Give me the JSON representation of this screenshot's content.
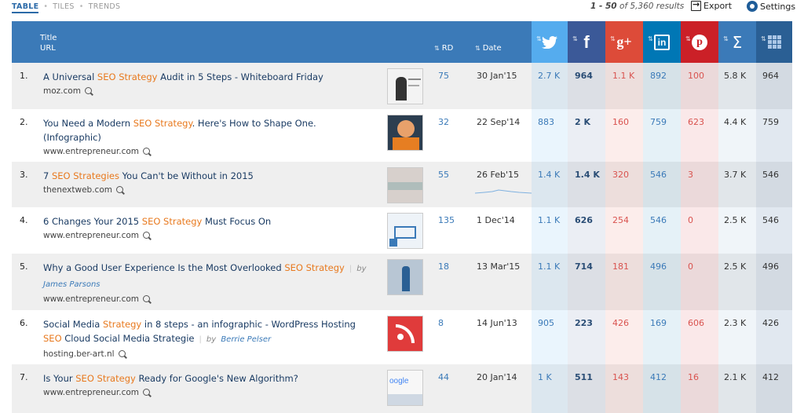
{
  "toolbar": {
    "view_table": "TABLE",
    "view_tiles": "TILES",
    "view_trends": "TRENDS",
    "results_range": "1 - 50",
    "results_text": "of 5,360 results",
    "export_label": "Export",
    "settings_label": "Settings"
  },
  "header": {
    "title_label": "Title",
    "url_label": "URL",
    "rd_label": "RD",
    "date_label": "Date",
    "twitter_icon": "twitter-icon",
    "facebook_icon": "facebook-icon",
    "googleplus_icon": "google-plus-icon",
    "linkedin_icon": "linkedin-icon",
    "pinterest_icon": "pinterest-icon",
    "total_icon": "sigma-icon",
    "grid_icon": "grid-icon"
  },
  "colors": {
    "header_blue": "#3b7ab8",
    "twitter": "#55acee",
    "facebook": "#3b5998",
    "googleplus": "#dd4b39",
    "linkedin": "#0077b5",
    "pinterest": "#cb2027",
    "keyword": "#e8791e"
  },
  "rows": [
    {
      "num": "1.",
      "pre": "A Universal ",
      "kw": "SEO Strategy",
      "post": " Audit in 5 Steps - Whiteboard Friday",
      "author": "",
      "domain": "moz.com",
      "rd": "75",
      "date": "30 Jan'15",
      "tw": "2.7 K",
      "fb": "964",
      "gp": "1.1 K",
      "li": "892",
      "pi": "100",
      "total": "5.8 K",
      "last": "964"
    },
    {
      "num": "2.",
      "pre": "You Need a Modern ",
      "kw": "SEO Strategy",
      "post": ". Here's How to Shape One. (Infographic)",
      "author": "",
      "domain": "www.entrepreneur.com",
      "rd": "32",
      "date": "22 Sep'14",
      "tw": "883",
      "fb": "2 K",
      "gp": "160",
      "li": "759",
      "pi": "623",
      "total": "4.4 K",
      "last": "759"
    },
    {
      "num": "3.",
      "pre": "7 ",
      "kw": "SEO Strategies",
      "post": " You Can't be Without in 2015",
      "author": "",
      "domain": "thenextweb.com",
      "rd": "55",
      "date": "26 Feb'15",
      "tw": "1.4 K",
      "fb": "1.4 K",
      "gp": "320",
      "li": "546",
      "pi": "3",
      "total": "3.7 K",
      "last": "546"
    },
    {
      "num": "4.",
      "pre": "6 Changes Your 2015 ",
      "kw": "SEO Strategy",
      "post": " Must Focus On",
      "author": "",
      "domain": "www.entrepreneur.com",
      "rd": "135",
      "date": "1 Dec'14",
      "tw": "1.1 K",
      "fb": "626",
      "gp": "254",
      "li": "546",
      "pi": "0",
      "total": "2.5 K",
      "last": "546"
    },
    {
      "num": "5.",
      "pre": "Why a Good User Experience Is the Most Overlooked ",
      "kw": "SEO Strategy",
      "post": "",
      "author_by": "by",
      "author": "James Parsons",
      "domain": "www.entrepreneur.com",
      "rd": "18",
      "date": "13 Mar'15",
      "tw": "1.1 K",
      "fb": "714",
      "gp": "181",
      "li": "496",
      "pi": "0",
      "total": "2.5 K",
      "last": "496"
    },
    {
      "num": "6.",
      "pre": "Social Media ",
      "kw": "Strategy",
      "post": " in 8 steps - an infographic - WordPress Hosting ",
      "kw2": "SEO",
      "post2": " Cloud Social Media Strategie",
      "author_by": "by",
      "author": "Berrie Pelser",
      "domain": "hosting.ber-art.nl",
      "rd": "8",
      "date": "14 Jun'13",
      "tw": "905",
      "fb": "223",
      "gp": "426",
      "li": "169",
      "pi": "606",
      "total": "2.3 K",
      "last": "426"
    },
    {
      "num": "7.",
      "pre": "Is Your ",
      "kw": "SEO Strategy",
      "post": " Ready for Google's New Algorithm?",
      "author": "",
      "domain": "www.entrepreneur.com",
      "rd": "44",
      "date": "20 Jan'14",
      "tw": "1 K",
      "fb": "511",
      "gp": "143",
      "li": "412",
      "pi": "16",
      "total": "2.1 K",
      "last": "412"
    }
  ]
}
